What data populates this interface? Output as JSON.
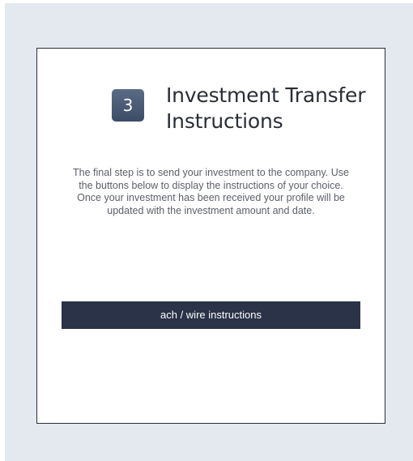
{
  "step": {
    "number": "3",
    "title": "Investment Transfer Instructions"
  },
  "description": "The final step is to send your investment to the company. Use the buttons below to display the instructions of your choice. Once your investment has been received your profile will be updated with the investment amount and date.",
  "actions": {
    "ach_wire_label": "ach / wire instructions"
  },
  "colors": {
    "page_background": "#e4e8ef",
    "card_background": "#ffffff",
    "card_border": "#2b2f36",
    "badge": "#4a5a76",
    "button": "#2a3347",
    "title_text": "#2a2e36",
    "body_text": "#5a5f68"
  }
}
